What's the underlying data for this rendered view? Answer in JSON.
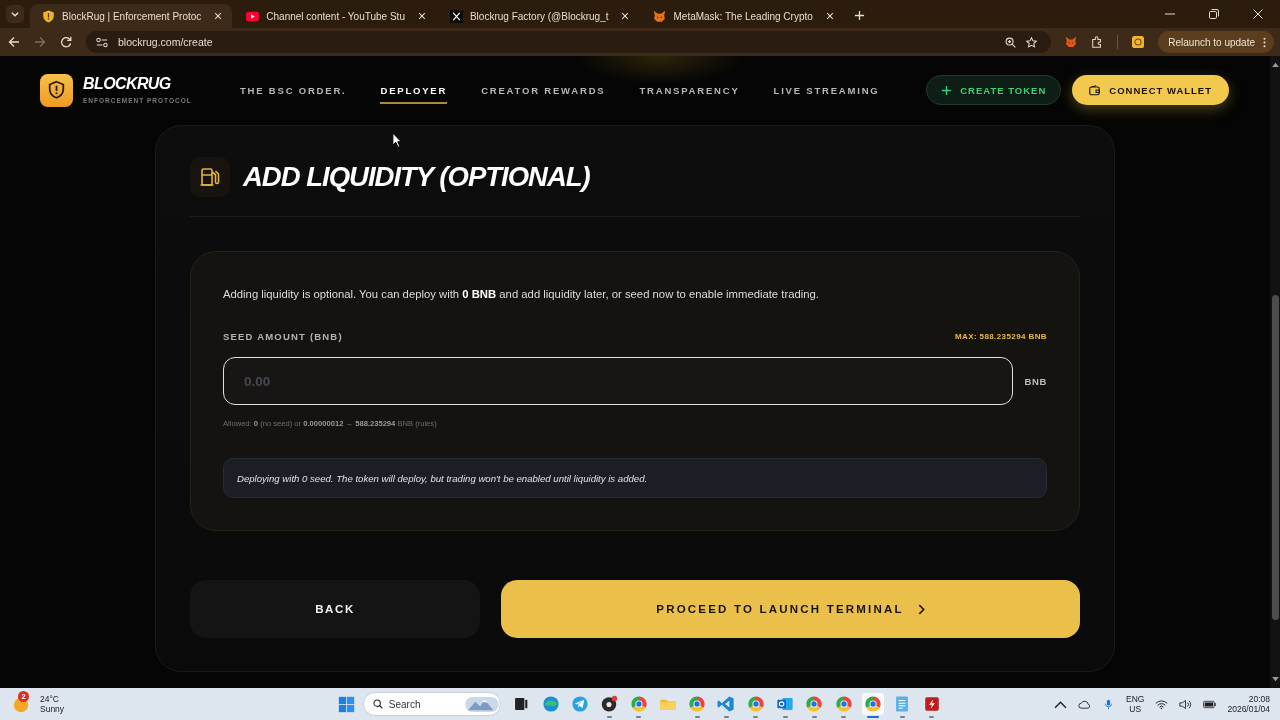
{
  "browser": {
    "tabs": [
      {
        "title": "BlockRug | Enforcement Protoc",
        "kind": "shield",
        "selected": true
      },
      {
        "title": "Channel content - YouTube Stu",
        "kind": "youtube",
        "selected": false
      },
      {
        "title": "Blockrug Factory (@Blockrug_t",
        "kind": "x",
        "selected": false
      },
      {
        "title": "MetaMask: The Leading Crypto",
        "kind": "fox",
        "selected": false
      }
    ],
    "url": "blockrug.com/create",
    "update_button": "Relaunch to update"
  },
  "header": {
    "logo_title": "BLOCKRUG",
    "logo_subtitle": "ENFORCEMENT PROTOCOL",
    "nav": [
      {
        "label": "THE BSC ORDER.",
        "selected": false
      },
      {
        "label": "DEPLOYER",
        "selected": true
      },
      {
        "label": "CREATOR REWARDS",
        "selected": false
      },
      {
        "label": "TRANSPARENCY",
        "selected": false
      },
      {
        "label": "LIVE STREAMING",
        "selected": false
      }
    ],
    "create_button": "CREATE TOKEN",
    "connect_button": "CONNECT WALLET"
  },
  "section": {
    "title": "ADD LIQUIDITY (OPTIONAL)",
    "intro": "Adding liquidity is optional. You can deploy with **0 BNB** and add liquidity later, or seed now to enable immediate trading.",
    "seed_label": "SEED AMOUNT (BNB)",
    "max": "MAX: 588.235294 BNB",
    "seed_field": {
      "placeholder": "0.00",
      "unit": "BNB"
    },
    "allowed": "Allowed: **0** (no seed) or **0.00000012** → **588.235294** BNB (rules)",
    "notice": "Deploying with 0 seed. The token will deploy, but trading won't be enabled until liquidity is added."
  },
  "actions": {
    "back": "BACK",
    "proceed": "PROCEED TO LAUNCH TERMINAL"
  },
  "taskbar": {
    "weather": {
      "badge": "2",
      "temperature": "24°C",
      "condition": "Sunny"
    },
    "search": {
      "placeholder": "Search"
    },
    "apps": [
      {
        "kind": "task-view",
        "running": false,
        "selected": false
      },
      {
        "kind": "edge",
        "running": false,
        "selected": false
      },
      {
        "kind": "telegram",
        "running": false,
        "selected": false
      },
      {
        "kind": "app",
        "running": true,
        "selected": false
      },
      {
        "kind": "chrome",
        "running": true,
        "selected": false
      },
      {
        "kind": "folder",
        "running": false,
        "selected": false
      },
      {
        "kind": "chrome",
        "running": true,
        "selected": false
      },
      {
        "kind": "vscode",
        "running": true,
        "selected": false
      },
      {
        "kind": "chrome",
        "running": true,
        "selected": false
      },
      {
        "kind": "outlook",
        "running": true,
        "selected": false
      },
      {
        "kind": "chrome",
        "running": true,
        "selected": false
      },
      {
        "kind": "chrome",
        "running": true,
        "selected": false
      },
      {
        "kind": "chrome",
        "running": true,
        "selected": true
      },
      {
        "kind": "notepad",
        "running": true,
        "selected": false
      },
      {
        "kind": "filezilla",
        "running": true,
        "selected": false
      }
    ],
    "language": "ENG",
    "region": "US",
    "time": "20:08",
    "date": "2026/01/04"
  }
}
